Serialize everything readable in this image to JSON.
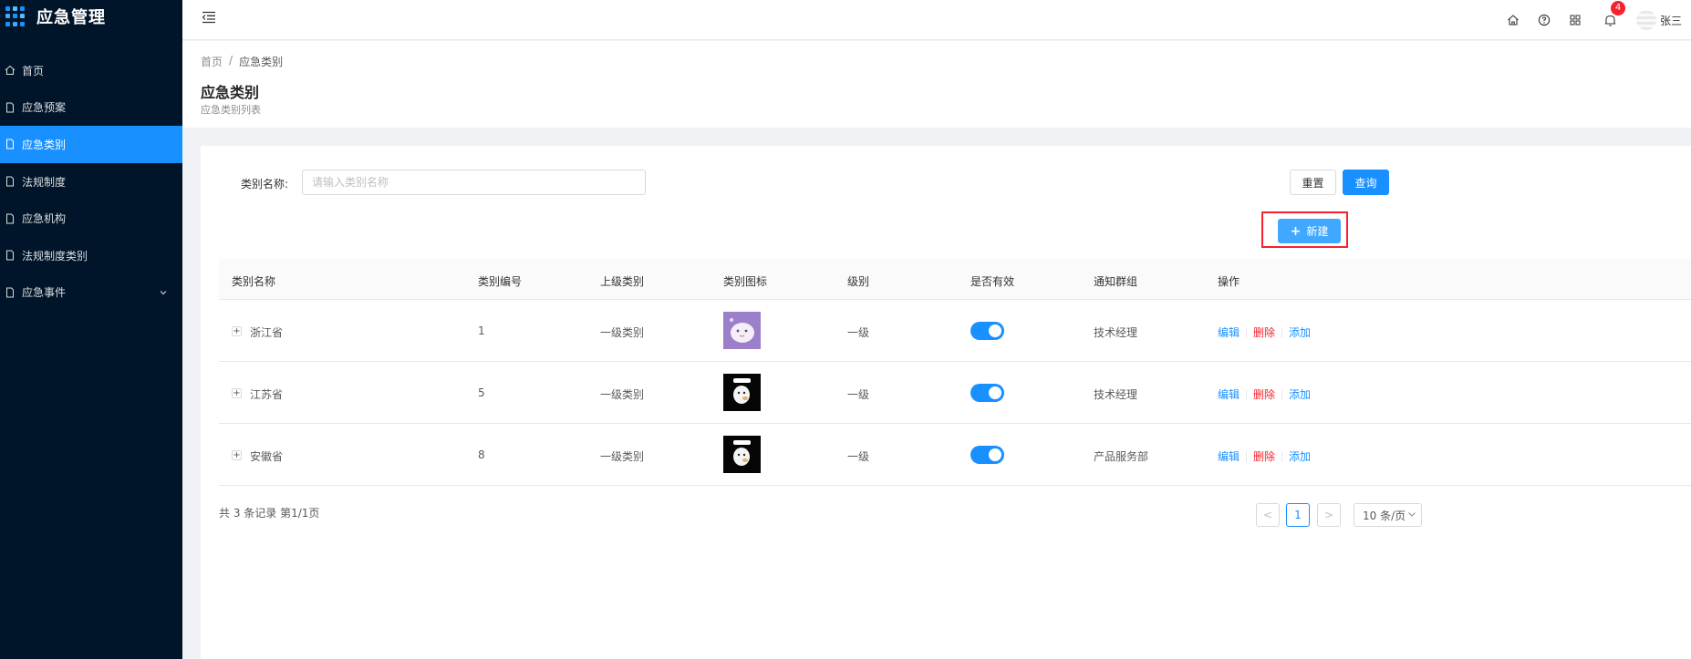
{
  "app": {
    "title": "应急管理"
  },
  "sidebar": {
    "items": [
      {
        "label": "首页",
        "icon": "home-icon",
        "active": false
      },
      {
        "label": "应急预案",
        "icon": "file-icon",
        "active": false
      },
      {
        "label": "应急类别",
        "icon": "file-icon",
        "active": true
      },
      {
        "label": "法规制度",
        "icon": "file-icon",
        "active": false
      },
      {
        "label": "应急机构",
        "icon": "file-icon",
        "active": false
      },
      {
        "label": "法规制度类别",
        "icon": "file-icon",
        "active": false
      },
      {
        "label": "应急事件",
        "icon": "file-icon",
        "active": false,
        "has_submenu": true
      }
    ]
  },
  "header": {
    "notification_count": "4",
    "username": "张三",
    "icons": [
      "home-icon",
      "help-icon",
      "apps-icon",
      "bell-icon"
    ]
  },
  "breadcrumb": {
    "home": "首页",
    "separator": "/",
    "current": "应急类别"
  },
  "page": {
    "title": "应急类别",
    "subtitle": "应急类别列表"
  },
  "search": {
    "label": "类别名称:",
    "placeholder": "请输入类别名称",
    "value": "",
    "reset_label": "重置",
    "query_label": "查询"
  },
  "toolbar": {
    "new_label": "新建"
  },
  "table": {
    "columns": [
      "类别名称",
      "类别编号",
      "上级类别",
      "类别图标",
      "级别",
      "是否有效",
      "通知群组",
      "操作"
    ],
    "rows": [
      {
        "name": "浙江省",
        "code": "1",
        "parent": "一级类别",
        "icon": "purple-cartoon-icon",
        "level": "一级",
        "valid": true,
        "group": "技术经理"
      },
      {
        "name": "江苏省",
        "code": "5",
        "parent": "一级类别",
        "icon": "black-cartoon-icon",
        "level": "一级",
        "valid": true,
        "group": "技术经理"
      },
      {
        "name": "安徽省",
        "code": "8",
        "parent": "一级类别",
        "icon": "black-cartoon-icon",
        "level": "一级",
        "valid": true,
        "group": "产品服务部"
      }
    ],
    "actions": {
      "edit": "编辑",
      "delete": "删除",
      "add": "添加"
    }
  },
  "pagination": {
    "total_text": "共 3 条记录 第1/1页",
    "current_page": "1",
    "page_size": "10 条/页",
    "prev_symbol": "<",
    "next_symbol": ">"
  },
  "colors": {
    "sidebar_bg": "#001529",
    "primary": "#1890ff",
    "danger": "#f5222d"
  }
}
